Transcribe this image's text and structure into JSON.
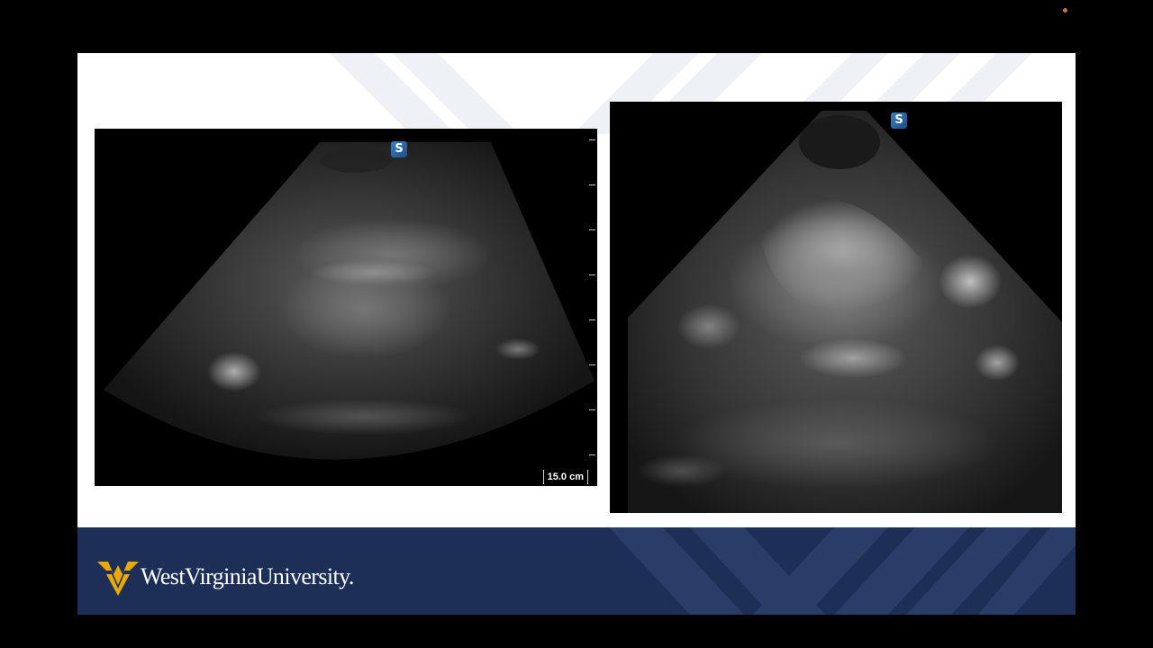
{
  "window": {
    "indicator_color": "#c8743a"
  },
  "slide": {
    "background": "#ffffff",
    "left_image": {
      "probe_logo_icon": "ultrasound-vendor-logo-icon",
      "scale_label": "15.0 cm",
      "depth_tick_count": 8
    },
    "right_image": {
      "probe_logo_icon": "ultrasound-vendor-logo-icon"
    },
    "footer": {
      "background": "#1d2f57",
      "logo_icon": "flying-wv-icon",
      "logo_color": "#eaaa00",
      "wordmark": "WestVirginiaUniversity."
    }
  }
}
